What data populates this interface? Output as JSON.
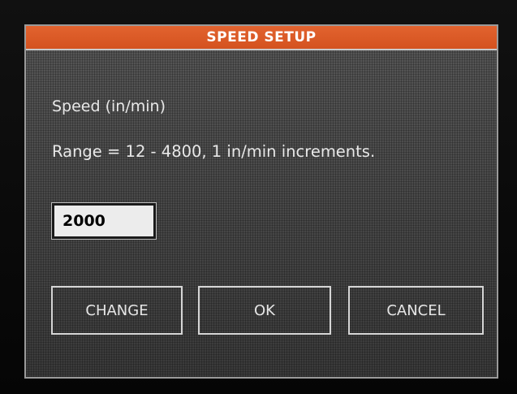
{
  "dialog": {
    "title": "SPEED SETUP",
    "speed_label": "Speed (in/min)",
    "range_text": "Range = 12 - 4800, 1 in/min increments.",
    "speed_value": "2000"
  },
  "buttons": {
    "change_label": "CHANGE",
    "ok_label": "OK",
    "cancel_label": "CANCEL"
  },
  "colors": {
    "titlebar": "#d9582a",
    "screen_bg": "#4a4a4a",
    "text": "#e8e8e8"
  }
}
